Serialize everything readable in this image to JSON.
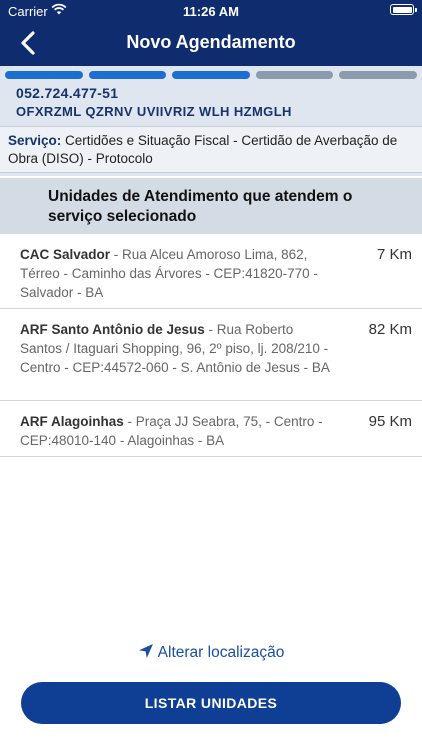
{
  "status_bar": {
    "carrier": "Carrier",
    "time": "11:26 AM"
  },
  "header": {
    "title": "Novo Agendamento"
  },
  "progress": {
    "steps_total": 5,
    "steps_completed": 3
  },
  "user": {
    "cpf": "052.724.477-51",
    "name": "OFXRZML QZRNV UVIIVRIZ WLH HZMGLH"
  },
  "service": {
    "label": "Serviço:",
    "value": "Certidões e Situação Fiscal - Certidão de Averbação de Obra (DISO) - Protocolo"
  },
  "section": {
    "title": "Unidades de Atendimento que atendem o serviço selecionado"
  },
  "units": [
    {
      "name": "CAC Salvador",
      "address": " - Rua Alceu Amoroso Lima, 862, Térreo - Caminho das Árvores - CEP:41820-770 - Salvador - BA",
      "distance": "7 Km"
    },
    {
      "name": "ARF Santo Antônio de Jesus",
      "address": " - Rua Roberto Santos / Itaguari Shopping, 96, 2º piso, lj. 208/210 - Centro - CEP:44572-060 - S. Antônio de Jesus - BA",
      "distance": "82 Km"
    },
    {
      "name": "ARF Alagoinhas",
      "address": " - Praça JJ Seabra, 75,  - Centro - CEP:48010-140 - Alagoinhas - BA",
      "distance": "95 Km"
    }
  ],
  "location": {
    "label": "Alterar localização"
  },
  "actions": {
    "list_label": "LISTAR UNIDADES"
  },
  "colors": {
    "header": "#0e2c6e",
    "accent": "#1c6fd1",
    "button": "#0e3f94"
  }
}
